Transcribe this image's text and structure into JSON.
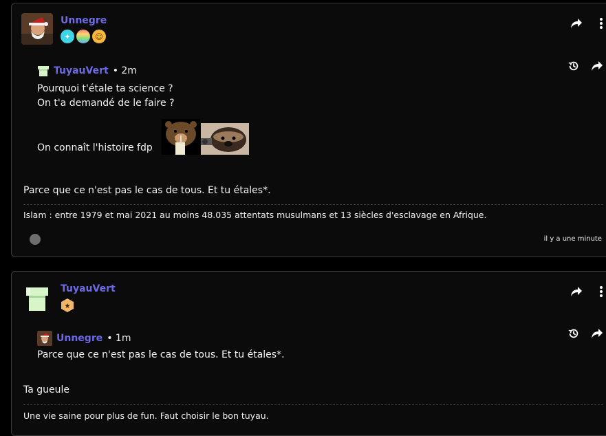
{
  "post1": {
    "author": "Unnegre",
    "badges": [
      "cyan-badge-icon",
      "rainbow-badge-icon",
      "emoji-badge-icon"
    ],
    "quote": {
      "author": "TuyauVert",
      "time": "• 2m",
      "lines": [
        "Pourquoi t'étale ta science ?",
        "On t'a demandé de le faire ?"
      ],
      "image_caption": "On connaît l'histoire fdp"
    },
    "body": "Parce que ce n'est pas le cas de tous. Et tu étales*.",
    "signature": "Islam : entre 1979 et mai 2021 au moins 48.035 attentats musulmans et 13 siècles d'esclavage en Afrique.",
    "timestamp": "il y a une minute"
  },
  "post2": {
    "author": "TuyauVert",
    "badges": [
      "star-badge-icon"
    ],
    "quote": {
      "author": "Unnegre",
      "time": "• 1m",
      "lines": [
        "Parce que ce n'est pas le cas de tous. Et tu étales*."
      ]
    },
    "body": "Ta gueule",
    "signature": "Une vie saine pour plus de fun. Faut choisir le bon tuyau."
  },
  "colors": {
    "author": "#6e69e6",
    "background": "#000000",
    "card": "#0b0b0b"
  }
}
